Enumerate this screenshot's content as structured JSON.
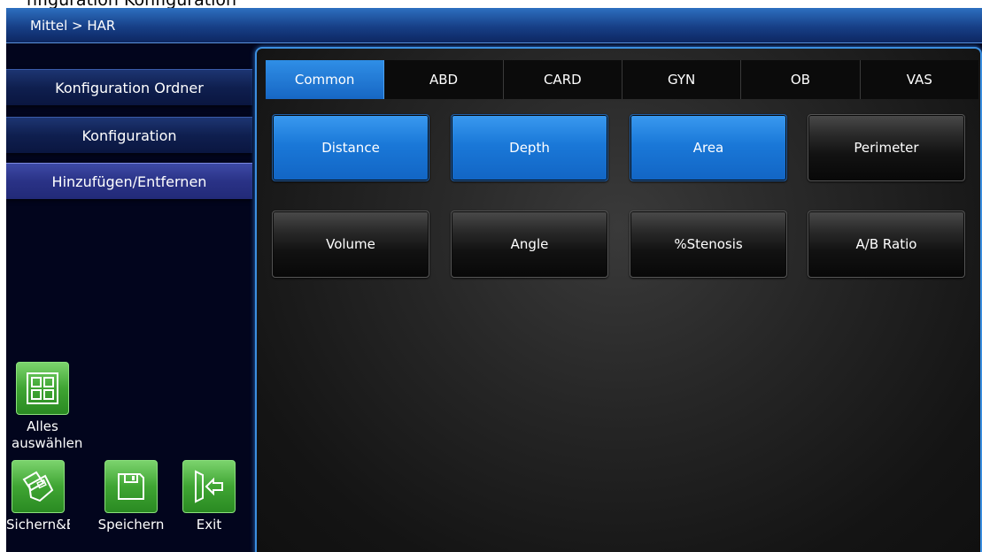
{
  "top_fragment": "nfiguration Konfiguration",
  "title_bar": {
    "breadcrumb": "Mittel > HAR"
  },
  "left_menu": {
    "items": [
      {
        "label": "Konfiguration Ordner",
        "active": false
      },
      {
        "label": "Konfiguration",
        "active": false
      },
      {
        "label": "Hinzufügen/Entfernen",
        "active": true
      }
    ]
  },
  "tabs": [
    {
      "label": "Common",
      "active": true
    },
    {
      "label": "ABD",
      "active": false
    },
    {
      "label": "CARD",
      "active": false
    },
    {
      "label": "GYN",
      "active": false
    },
    {
      "label": "OB",
      "active": false
    },
    {
      "label": "VAS",
      "active": false
    }
  ],
  "measurements": [
    {
      "label": "Distance",
      "selected": true
    },
    {
      "label": "Depth",
      "selected": true
    },
    {
      "label": "Area",
      "selected": true
    },
    {
      "label": "Perimeter",
      "selected": false
    },
    {
      "label": "Volume",
      "selected": false
    },
    {
      "label": "Angle",
      "selected": false
    },
    {
      "label": "%Stenosis",
      "selected": false
    },
    {
      "label": "A/B Ratio",
      "selected": false
    }
  ],
  "actions": {
    "select_all": {
      "label": "Alles auswählen",
      "icon": "select-all-grid-icon"
    },
    "save_exit": {
      "label": "Sichern&Exit",
      "icon": "save-exit-icon"
    },
    "save": {
      "label": "Speichern",
      "icon": "floppy-disk-icon"
    },
    "exit": {
      "label": "Exit",
      "icon": "exit-arrow-icon"
    }
  },
  "colors": {
    "accent_blue": "#1a78d8",
    "action_green": "#3fa533",
    "title_bar_blue": "#173f86"
  }
}
